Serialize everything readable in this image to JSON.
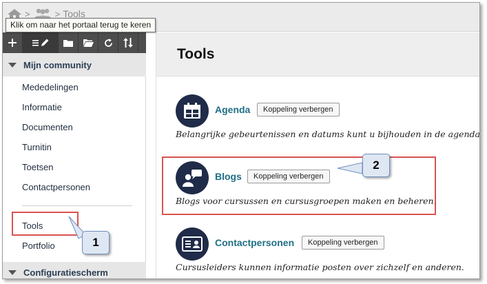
{
  "breadcrumb": {
    "current": "Tools",
    "separator": ">",
    "tooltip": "Klik om naar het portaal terug te keren"
  },
  "toolbar": {
    "icons": [
      "plus-icon",
      "edit-list-icon",
      "folder-icon",
      "folder-open-icon",
      "refresh-icon",
      "sort-icon"
    ]
  },
  "sidebar": {
    "sections": [
      {
        "title": "Mijn community"
      },
      {
        "title": "Configuratiescherm"
      }
    ],
    "items": [
      {
        "label": "Mededelingen"
      },
      {
        "label": "Informatie"
      },
      {
        "label": "Documenten"
      },
      {
        "label": "Turnitin"
      },
      {
        "label": "Toetsen"
      },
      {
        "label": "Contactpersonen"
      },
      {
        "label": "Tools"
      },
      {
        "label": "Portfolio"
      }
    ]
  },
  "main": {
    "title": "Tools",
    "tools": [
      {
        "name": "Agenda",
        "button": "Koppeling verbergen",
        "description": "Belangrijke gebeurtenissen en datums kunt u bijhouden in de agenda.",
        "icon": "calendar-icon"
      },
      {
        "name": "Blogs",
        "button": "Koppeling verbergen",
        "description": "Blogs voor cursussen en cursusgroepen maken en beheren.",
        "icon": "blog-icon"
      },
      {
        "name": "Contactpersonen",
        "button": "Koppeling verbergen",
        "description": "Cursusleiders kunnen informatie posten over zichzelf en anderen.",
        "icon": "contact-card-icon"
      }
    ]
  },
  "annotations": {
    "callout_1": "1",
    "callout_2": "2",
    "highlight_color": "#d9534f",
    "callout_color": "#dfe7f3"
  },
  "colors": {
    "accent_link": "#1f6f86",
    "icon_circle": "#1f2b48",
    "toolbar_bg": "#4d4d4d"
  }
}
